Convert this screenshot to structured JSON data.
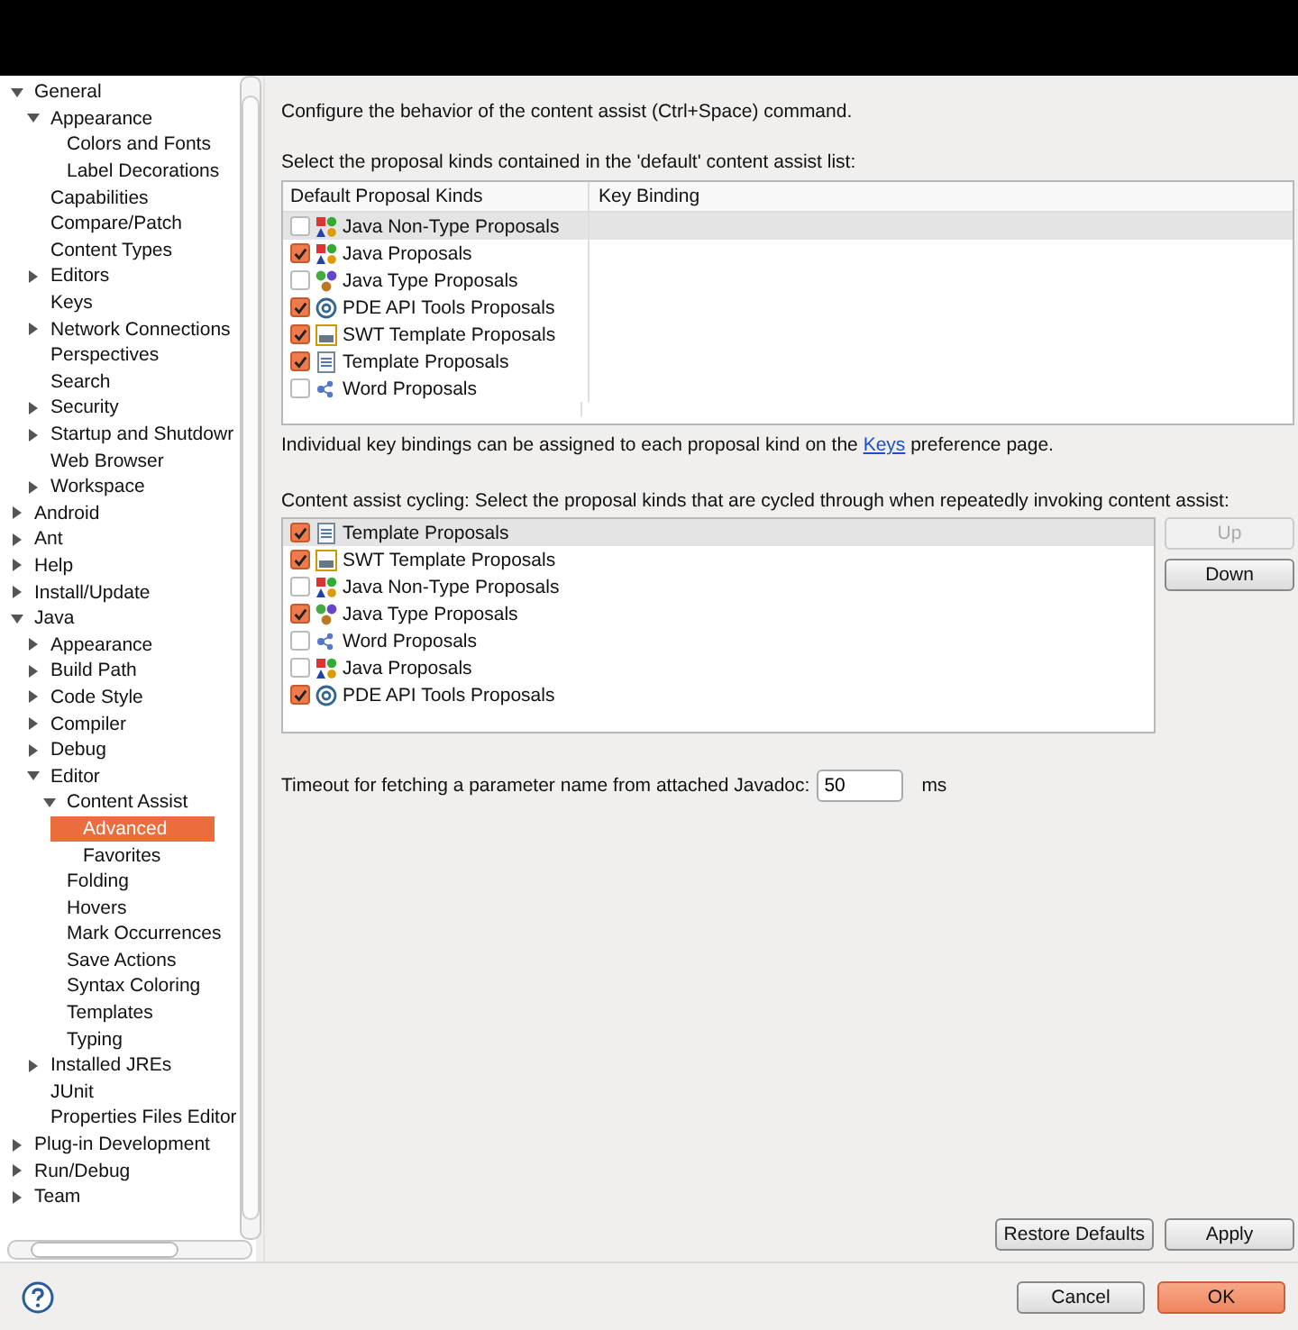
{
  "tree": [
    {
      "label": "General",
      "expanded": true,
      "selected": false,
      "children": [
        {
          "label": "Appearance",
          "expanded": true,
          "selected": false,
          "children": [
            {
              "label": "Colors and Fonts",
              "selected": false
            },
            {
              "label": "Label Decorations",
              "selected": false
            }
          ]
        },
        {
          "label": "Capabilities",
          "selected": false
        },
        {
          "label": "Compare/Patch",
          "selected": false
        },
        {
          "label": "Content Types",
          "selected": false
        },
        {
          "label": "Editors",
          "expanded": false,
          "selected": false
        },
        {
          "label": "Keys",
          "selected": false
        },
        {
          "label": "Network Connections",
          "expanded": false,
          "selected": false
        },
        {
          "label": "Perspectives",
          "selected": false
        },
        {
          "label": "Search",
          "selected": false
        },
        {
          "label": "Security",
          "expanded": false,
          "selected": false
        },
        {
          "label": "Startup and Shutdowr",
          "expanded": false,
          "selected": false
        },
        {
          "label": "Web Browser",
          "selected": false
        },
        {
          "label": "Workspace",
          "expanded": false,
          "selected": false
        }
      ]
    },
    {
      "label": "Android",
      "expanded": false,
      "selected": false
    },
    {
      "label": "Ant",
      "expanded": false,
      "selected": false
    },
    {
      "label": "Help",
      "expanded": false,
      "selected": false
    },
    {
      "label": "Install/Update",
      "expanded": false,
      "selected": false
    },
    {
      "label": "Java",
      "expanded": true,
      "selected": false,
      "children": [
        {
          "label": "Appearance",
          "expanded": false,
          "selected": false
        },
        {
          "label": "Build Path",
          "expanded": false,
          "selected": false
        },
        {
          "label": "Code Style",
          "expanded": false,
          "selected": false
        },
        {
          "label": "Compiler",
          "expanded": false,
          "selected": false
        },
        {
          "label": "Debug",
          "expanded": false,
          "selected": false
        },
        {
          "label": "Editor",
          "expanded": true,
          "selected": false,
          "children": [
            {
              "label": "Content Assist",
              "expanded": true,
              "selected": false,
              "children": [
                {
                  "label": "Advanced",
                  "selected": true
                },
                {
                  "label": "Favorites",
                  "selected": false
                }
              ]
            },
            {
              "label": "Folding",
              "selected": false
            },
            {
              "label": "Hovers",
              "selected": false
            },
            {
              "label": "Mark Occurrences",
              "selected": false
            },
            {
              "label": "Save Actions",
              "selected": false
            },
            {
              "label": "Syntax Coloring",
              "selected": false
            },
            {
              "label": "Templates",
              "selected": false
            },
            {
              "label": "Typing",
              "selected": false
            }
          ]
        },
        {
          "label": "Installed JREs",
          "expanded": false,
          "selected": false
        },
        {
          "label": "JUnit",
          "selected": false
        },
        {
          "label": "Properties Files Editor",
          "selected": false
        }
      ]
    },
    {
      "label": "Plug-in Development",
      "expanded": false,
      "selected": false
    },
    {
      "label": "Run/Debug",
      "expanded": false,
      "selected": false
    },
    {
      "label": "Team",
      "expanded": false,
      "selected": false
    }
  ],
  "intro": "Configure the behavior of the content assist (Ctrl+Space) command.",
  "default_list": {
    "label": "Select the proposal kinds contained in the 'default' content assist list:",
    "columns": [
      "Default Proposal Kinds",
      "Key Binding"
    ],
    "rows": [
      {
        "name": "Java Non-Type Proposals",
        "kind": "java",
        "checked": false,
        "selected": true
      },
      {
        "name": "Java Proposals",
        "kind": "java",
        "checked": true,
        "selected": false
      },
      {
        "name": "Java Type Proposals",
        "kind": "type",
        "checked": false,
        "selected": false
      },
      {
        "name": "PDE API Tools Proposals",
        "kind": "pde",
        "checked": true,
        "selected": false
      },
      {
        "name": "SWT Template Proposals",
        "kind": "swt",
        "checked": true,
        "selected": false
      },
      {
        "name": "Template Proposals",
        "kind": "template",
        "checked": true,
        "selected": false
      },
      {
        "name": "Word Proposals",
        "kind": "word",
        "checked": false,
        "selected": false
      }
    ]
  },
  "keys_note": {
    "before": "Individual key bindings can be assigned to each proposal kind on the ",
    "link": "Keys",
    "after": " preference page."
  },
  "cycling": {
    "label": "Content assist cycling: Select the proposal kinds that are cycled through when repeatedly invoking content assist:",
    "rows": [
      {
        "name": "Template Proposals",
        "kind": "template",
        "checked": true,
        "selected": true
      },
      {
        "name": "SWT Template Proposals",
        "kind": "swt",
        "checked": true,
        "selected": false
      },
      {
        "name": "Java Non-Type Proposals",
        "kind": "java",
        "checked": false,
        "selected": false
      },
      {
        "name": "Java Type Proposals",
        "kind": "type",
        "checked": true,
        "selected": false
      },
      {
        "name": "Word Proposals",
        "kind": "word",
        "checked": false,
        "selected": false
      },
      {
        "name": "Java Proposals",
        "kind": "java",
        "checked": false,
        "selected": false
      },
      {
        "name": "PDE API Tools Proposals",
        "kind": "pde",
        "checked": true,
        "selected": false
      }
    ],
    "buttons": [
      {
        "label": "Up",
        "disabled": true
      },
      {
        "label": "Down",
        "disabled": false
      }
    ]
  },
  "timeout": {
    "label": "Timeout for fetching a parameter name from attached Javadoc:",
    "value": "50",
    "unit": "ms"
  },
  "page_buttons": [
    "Restore Defaults",
    "Apply"
  ],
  "dialog_buttons": [
    {
      "label": "Cancel",
      "primary": false
    },
    {
      "label": "OK",
      "primary": true
    }
  ]
}
